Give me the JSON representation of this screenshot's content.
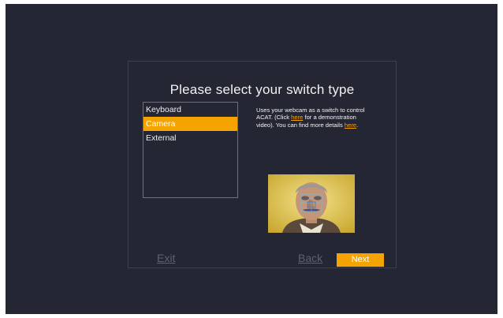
{
  "dialog": {
    "title": "Please select your switch type",
    "switch_types": [
      "Keyboard",
      "Camera",
      "External"
    ],
    "selected": "Camera",
    "description": {
      "part1": "Uses your webcam as a switch to control ACAT. (Click ",
      "link1": "here",
      "part2": " for a demonstration video). You can find more details ",
      "link2": "here",
      "part3": "."
    },
    "buttons": {
      "exit": "Exit",
      "back": "Back",
      "next": "Next"
    }
  },
  "colors": {
    "background": "#252634",
    "accent": "#f5a300",
    "disabled_text": "#5d6074",
    "list_border": "#6d7080"
  },
  "icons": {
    "preview": "webcam-face-tracking-image"
  }
}
